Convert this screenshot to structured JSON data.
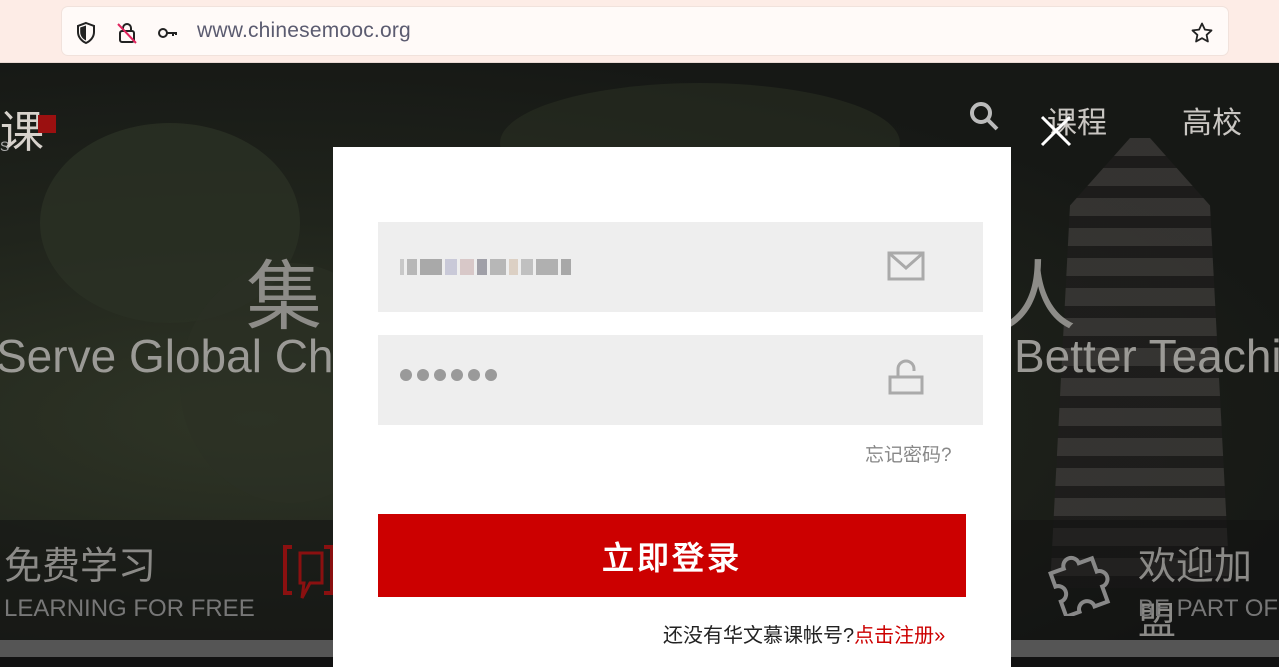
{
  "browser": {
    "url_host": "www.chinesemooc.org"
  },
  "background": {
    "logo_char": "课",
    "logo_sub": "S",
    "nav": [
      "课程",
      "高校"
    ],
    "hero_cn_left": "集",
    "hero_cn_right": "人",
    "hero_en_left": "Serve Global Chin",
    "hero_en_right": "Better Teachi",
    "features": [
      {
        "cn": "免费学习",
        "en": "LEARNING FOR FREE"
      },
      {
        "cn": "欢迎加盟",
        "en": "BE PART OF"
      }
    ]
  },
  "login": {
    "username_value": "",
    "password_dots": 6,
    "forgot_label": "忘记密码?",
    "submit_label": "立即登录",
    "no_account_text": "还没有华文慕课帐号?",
    "register_link": "点击注册»"
  },
  "colors": {
    "brand_red": "#cc0000",
    "field_bg": "#eeeeee"
  }
}
